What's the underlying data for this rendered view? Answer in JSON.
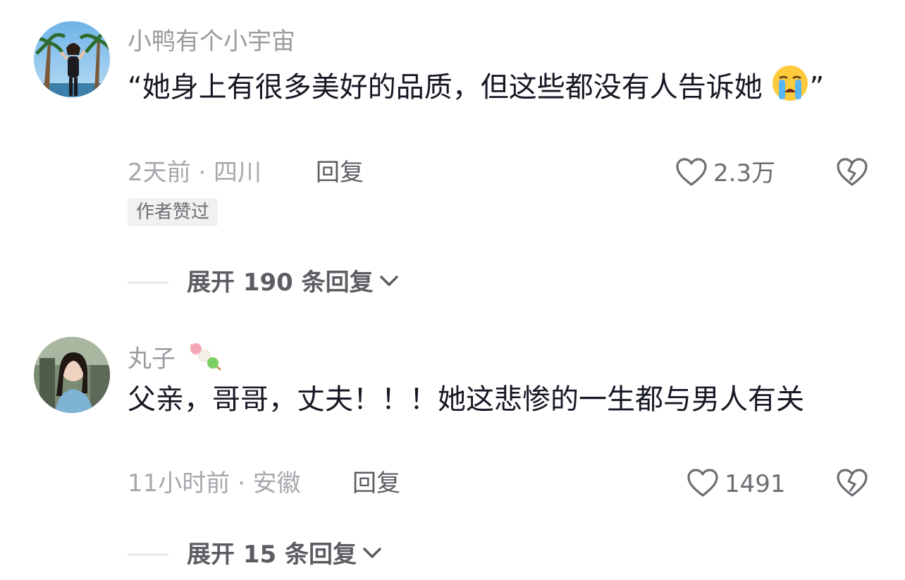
{
  "comments": [
    {
      "username": "小鸭有个小宇宙",
      "content": "“她身上有很多美好的品质，但这些都没有人告诉她",
      "content_tail": "”",
      "emoji": "loudly-crying-face",
      "time_location": "2天前 · 四川",
      "reply_label": "回复",
      "like_count": "2.3万",
      "badge": "作者赞过",
      "expand_label": "展开 190 条回复"
    },
    {
      "username": "丸子",
      "username_emoji": "dango",
      "content": "父亲，哥哥，丈夫！！！她这悲惨的一生都与男人有关",
      "time_location": "11小时前 · 安徽",
      "reply_label": "回复",
      "like_count": "1491",
      "expand_label": "展开 15 条回复"
    }
  ],
  "colors": {
    "text_primary": "#161823",
    "text_secondary": "#a7a7ad",
    "badge_bg": "#f1f1f2"
  }
}
